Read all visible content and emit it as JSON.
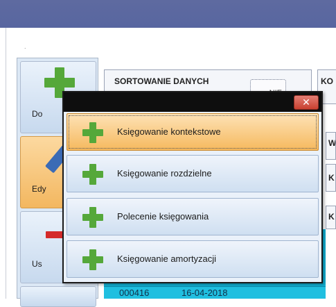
{
  "colors": {
    "title_bar": "#5e6aa0",
    "accent_orange": "#f6b95e",
    "plus_green": "#55a83a",
    "minus_red": "#d42a2a",
    "table_cyan": "#12b4d8",
    "close_red": "#c8402f"
  },
  "window": {
    "dot": "."
  },
  "sidebar": {
    "items": [
      {
        "label": "Do",
        "icon": "plus-icon",
        "active": false
      },
      {
        "label": "Edy",
        "icon": "pen-icon",
        "active": true
      },
      {
        "label": "Us",
        "icon": "minus-icon",
        "active": false
      }
    ]
  },
  "sort": {
    "title": "SORTOWANIE DANYCH",
    "nie_label": "NIE",
    "ko_label": "KO"
  },
  "right_clips": [
    "WI",
    "K",
    "K"
  ],
  "table": {
    "row": {
      "id": "000416",
      "date": "16-04-2018"
    }
  },
  "popup": {
    "close_icon": "close-icon",
    "items": [
      {
        "label": "Księgowanie kontekstowe",
        "icon": "plus-icon",
        "active": true
      },
      {
        "label": "Księgowanie rozdzielne",
        "icon": "plus-icon",
        "active": false
      },
      {
        "label": "Polecenie księgowania",
        "icon": "plus-icon",
        "active": false
      },
      {
        "label": "Księgowanie amortyzacji",
        "icon": "plus-icon",
        "active": false
      }
    ]
  }
}
